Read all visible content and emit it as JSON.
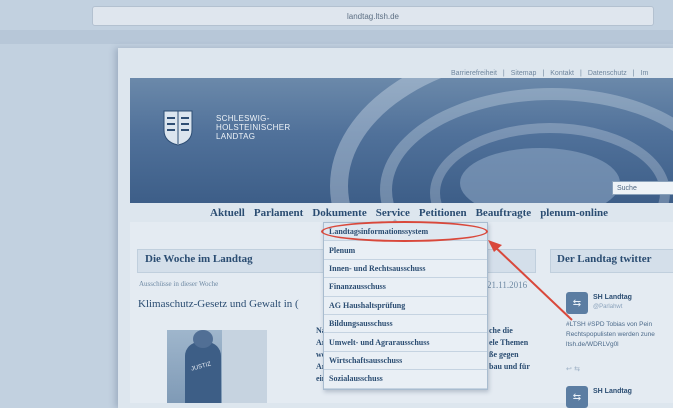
{
  "browser": {
    "url": "landtag.ltsh.de"
  },
  "top_links": [
    "Barrierefreiheit",
    "|",
    "Sitemap",
    "|",
    "Kontakt",
    "|",
    "Datenschutz",
    "|",
    "Im"
  ],
  "brand": {
    "line1": "SCHLESWIG-",
    "line2": "HOLSTEINISCHER",
    "line3": "LANDTAG"
  },
  "search": {
    "placeholder": "Suche"
  },
  "nav": [
    "Aktuell",
    "Parlament",
    "Dokumente",
    "Service",
    "Petitionen",
    "Beauftragte",
    "plenum-online"
  ],
  "dropdown": [
    "Landtagsinformationssystem",
    "Plenum",
    "Innen- und Rechtsausschuss",
    "Finanzausschuss",
    "AG Haushaltsprüfung",
    "Bildungsausschuss",
    "Umwelt- und Agrarausschuss",
    "Wirtschaftsausschuss",
    "Sozialausschuss"
  ],
  "woche": {
    "title": "Die Woche im Landtag",
    "subtitle": "Ausschüsse in dieser Woche",
    "date": "21.11.2016",
    "headline": "Klimaschutz-Gesetz und Gewalt in (",
    "photo_label": "JUSTIZ",
    "left_text": [
      "Na",
      "Ar",
      "we",
      "Ar",
      "ein"
    ],
    "right_text": [
      "che die",
      "ele Themen",
      "ße gegen",
      "bau und für"
    ]
  },
  "twitter": {
    "title": "Der Landtag twitter",
    "tweet1": {
      "name": "SH Landtag",
      "handle": "@Parlahwt",
      "text": [
        "#LTSH #SPD Tobias von Pein",
        "Rechtspopulisten werden zune",
        "ltsh.de/WDRLVg0l"
      ]
    },
    "tweet2": {
      "name": "SH Landtag"
    },
    "actions": "↩  ⇆"
  },
  "colors": {
    "highlight": "#d9483b",
    "primary_text": "#2b4d72",
    "banner": "#50719a"
  }
}
